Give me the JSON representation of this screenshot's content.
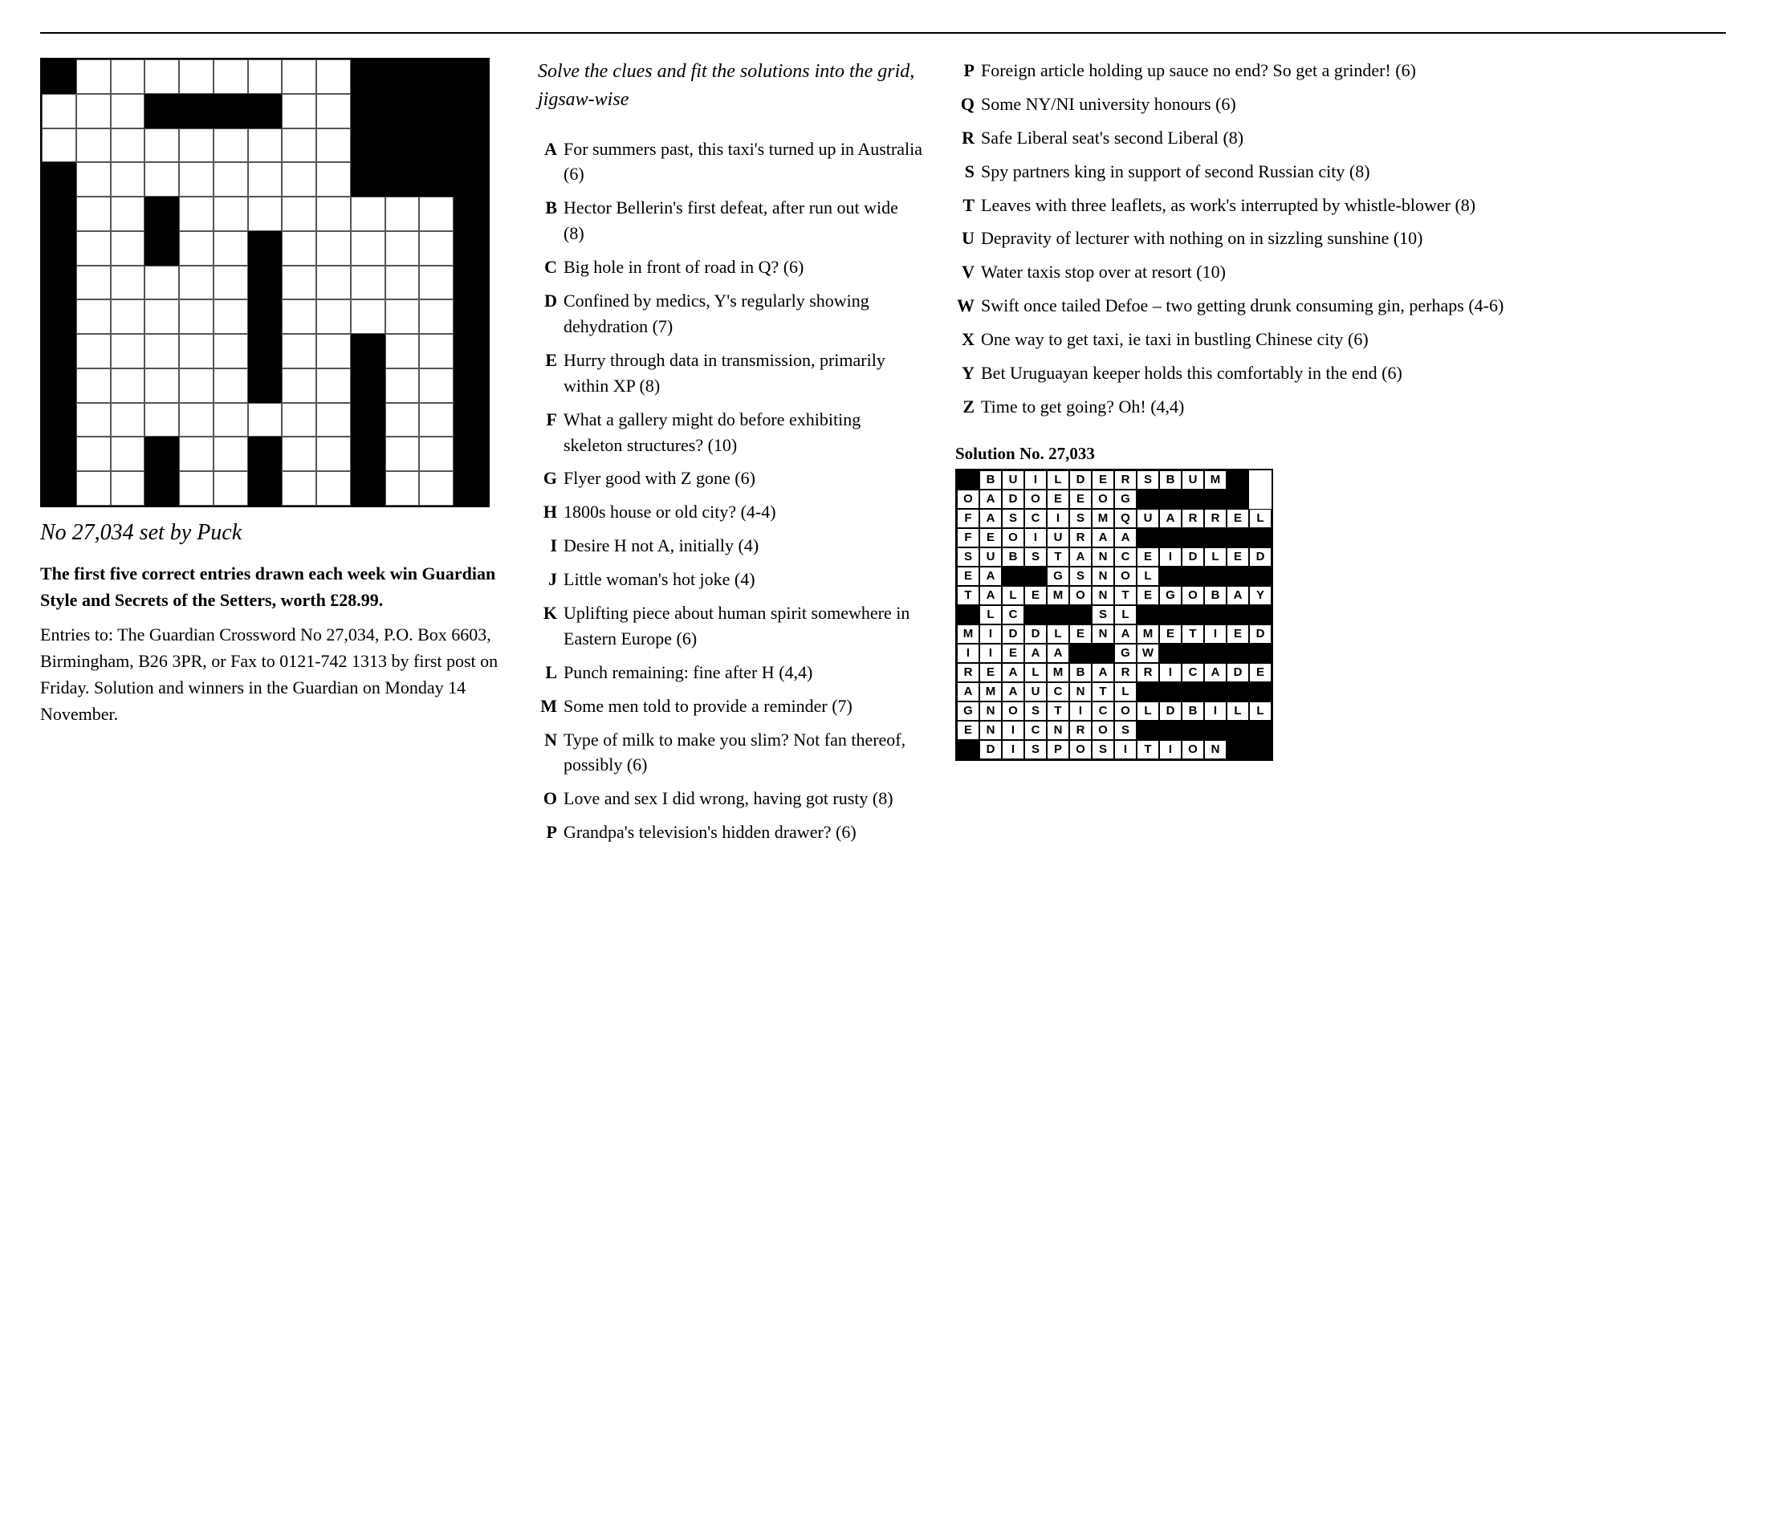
{
  "page": {
    "top_rule": true
  },
  "puzzle": {
    "label": "No 27,034 set by Puck",
    "prize_text_bold": "The first five correct entries drawn each week win Guardian Style and Secrets of the Setters, worth £28.99.",
    "prize_text_normal": "Entries to: The Guardian Crossword No 27,034, P.O. Box 6603, Birmingham, B26 3PR, or Fax to 0121-742 1313 by first post on Friday. Solution and winners in the Guardian on Monday 14 November."
  },
  "instruction": "Solve the clues and fit the solutions into the grid, jigsaw-wise",
  "clues_left": [
    {
      "letter": "A",
      "text": "For summers past, this taxi's turned up in Australia (6)"
    },
    {
      "letter": "B",
      "text": "Hector Bellerin's first defeat, after run out wide (8)"
    },
    {
      "letter": "C",
      "text": "Big hole in front of road in Q? (6)"
    },
    {
      "letter": "D",
      "text": "Confined by medics, Y's regularly showing dehydration (7)"
    },
    {
      "letter": "E",
      "text": "Hurry through data in transmission, primarily within XP (8)"
    },
    {
      "letter": "F",
      "text": "What a gallery might do before exhibiting skeleton structures? (10)"
    },
    {
      "letter": "G",
      "text": "Flyer good with Z gone (6)"
    },
    {
      "letter": "H",
      "text": "1800s house or old city? (4-4)"
    },
    {
      "letter": "I",
      "text": "Desire H not A, initially (4)"
    },
    {
      "letter": "J",
      "text": "Little woman's hot joke (4)"
    },
    {
      "letter": "K",
      "text": "Uplifting piece about human spirit somewhere in Eastern Europe (6)"
    },
    {
      "letter": "L",
      "text": "Punch remaining: fine after H (4,4)"
    },
    {
      "letter": "M",
      "text": "Some men told to provide a reminder (7)"
    },
    {
      "letter": "N",
      "text": "Type of milk to make you slim? Not fan thereof, possibly (6)"
    },
    {
      "letter": "O",
      "text": "Love and sex I did wrong, having got rusty (8)"
    },
    {
      "letter": "P",
      "text": "Grandpa's television's hidden drawer? (6)"
    }
  ],
  "clues_right": [
    {
      "letter": "P",
      "text": "Foreign article holding up sauce no end? So get a grinder! (6)"
    },
    {
      "letter": "Q",
      "text": "Some NY/NI university honours (6)"
    },
    {
      "letter": "R",
      "text": "Safe Liberal seat's second Liberal (8)"
    },
    {
      "letter": "S",
      "text": "Spy partners king in support of second Russian city (8)"
    },
    {
      "letter": "T",
      "text": "Leaves with three leaflets, as work's interrupted by whistle-blower (8)"
    },
    {
      "letter": "U",
      "text": "Depravity of lecturer with nothing on in sizzling sunshine (10)"
    },
    {
      "letter": "V",
      "text": "Water taxis stop over at resort (10)"
    },
    {
      "letter": "W",
      "text": "Swift once tailed Defoe – two getting drunk consuming gin, perhaps (4-6)"
    },
    {
      "letter": "X",
      "text": "One way to get taxi, ie taxi in bustling Chinese city (6)"
    },
    {
      "letter": "Y",
      "text": "Bet Uruguayan keeper holds this comfortably in the end (6)"
    },
    {
      "letter": "Z",
      "text": "Time to get going? Oh! (4,4)"
    }
  ],
  "solution": {
    "title": "Solution No. 27,033",
    "rows": [
      [
        " ",
        "B",
        "U",
        "I",
        "L",
        "D",
        "E",
        "R",
        "S",
        "B",
        "U",
        "M",
        " "
      ],
      [
        "O",
        "A",
        "D",
        "O",
        "E",
        "E",
        "O",
        "G",
        " ",
        " ",
        " ",
        " ",
        " "
      ],
      [
        "F",
        "A",
        "S",
        "C",
        "I",
        "S",
        "M",
        "Q",
        "U",
        "A",
        "R",
        "R",
        "E",
        "L"
      ],
      [
        "F",
        "E",
        "O",
        "I",
        "U",
        "R",
        "A",
        "A",
        " ",
        " ",
        " ",
        " ",
        " ",
        " "
      ],
      [
        "S",
        "U",
        "B",
        "S",
        "T",
        "A",
        "N",
        "C",
        "E",
        "I",
        "D",
        "L",
        "E",
        "D"
      ],
      [
        "E",
        "A",
        " ",
        " ",
        "G",
        "S",
        "N",
        "O",
        "L",
        " ",
        " ",
        " ",
        " ",
        " "
      ],
      [
        "T",
        "A",
        "L",
        "E",
        "M",
        "O",
        "N",
        "T",
        "E",
        "G",
        "O",
        "B",
        "A",
        "Y"
      ],
      [
        " ",
        "L",
        "C",
        " ",
        " ",
        " ",
        "S",
        "L",
        " ",
        " ",
        " ",
        " ",
        " ",
        " "
      ],
      [
        "M",
        "I",
        "D",
        "D",
        "L",
        "E",
        "N",
        "A",
        "M",
        "E",
        "T",
        "I",
        "E",
        "D"
      ],
      [
        "I",
        "I",
        "E",
        "A",
        "A",
        " ",
        " ",
        "G",
        "W",
        " ",
        " ",
        " ",
        " ",
        " "
      ],
      [
        "R",
        "E",
        "A",
        "L",
        "M",
        "B",
        "A",
        "R",
        "R",
        "I",
        "C",
        "A",
        "D",
        "E"
      ],
      [
        "A",
        "M",
        "A",
        "U",
        "C",
        "N",
        "T",
        "L",
        " ",
        " ",
        " ",
        " ",
        " ",
        " "
      ],
      [
        "G",
        "N",
        "O",
        "S",
        "T",
        "I",
        "C",
        "O",
        "L",
        "D",
        "B",
        "I",
        "L",
        "L"
      ],
      [
        "E",
        "N",
        "I",
        "C",
        "N",
        "R",
        "O",
        "S",
        " ",
        " ",
        " ",
        " ",
        " ",
        " "
      ],
      [
        " ",
        "D",
        "I",
        "S",
        "P",
        "O",
        "S",
        "I",
        "T",
        "I",
        "O",
        "N",
        " ",
        " "
      ]
    ]
  },
  "grid_pattern": {
    "blacks": [
      [
        0,
        0
      ],
      [
        0,
        3
      ],
      [
        0,
        4
      ],
      [
        0,
        5
      ],
      [
        0,
        6
      ],
      [
        0,
        7
      ],
      [
        0,
        8
      ],
      [
        0,
        9
      ],
      [
        0,
        10
      ],
      [
        0,
        11
      ],
      [
        0,
        12
      ],
      [
        1,
        0
      ],
      [
        1,
        3
      ],
      [
        1,
        4
      ],
      [
        1,
        5
      ],
      [
        1,
        6
      ],
      [
        1,
        7
      ],
      [
        1,
        8
      ],
      [
        1,
        9
      ],
      [
        1,
        10
      ],
      [
        1,
        11
      ],
      [
        1,
        12
      ],
      [
        2,
        5
      ],
      [
        2,
        9
      ],
      [
        2,
        12
      ],
      [
        3,
        0
      ],
      [
        3,
        5
      ],
      [
        3,
        9
      ],
      [
        3,
        12
      ],
      [
        4,
        3
      ],
      [
        4,
        6
      ],
      [
        4,
        9
      ],
      [
        4,
        12
      ],
      [
        5,
        0
      ],
      [
        5,
        3
      ],
      [
        5,
        6
      ],
      [
        5,
        9
      ],
      [
        5,
        12
      ],
      [
        6,
        0
      ],
      [
        6,
        6
      ],
      [
        6,
        9
      ],
      [
        6,
        12
      ],
      [
        7,
        0
      ],
      [
        7,
        3
      ],
      [
        7,
        6
      ],
      [
        7,
        9
      ],
      [
        7,
        12
      ],
      [
        8,
        0
      ],
      [
        8,
        3
      ],
      [
        8,
        6
      ],
      [
        8,
        9
      ],
      [
        8,
        12
      ],
      [
        9,
        0
      ],
      [
        9,
        3
      ],
      [
        9,
        6
      ],
      [
        9,
        9
      ],
      [
        9,
        12
      ],
      [
        10,
        0
      ],
      [
        10,
        3
      ],
      [
        10,
        9
      ],
      [
        10,
        12
      ],
      [
        11,
        0
      ],
      [
        11,
        6
      ],
      [
        11,
        9
      ],
      [
        11,
        12
      ],
      [
        12,
        0
      ],
      [
        12,
        6
      ],
      [
        12,
        9
      ],
      [
        12,
        12
      ]
    ]
  }
}
